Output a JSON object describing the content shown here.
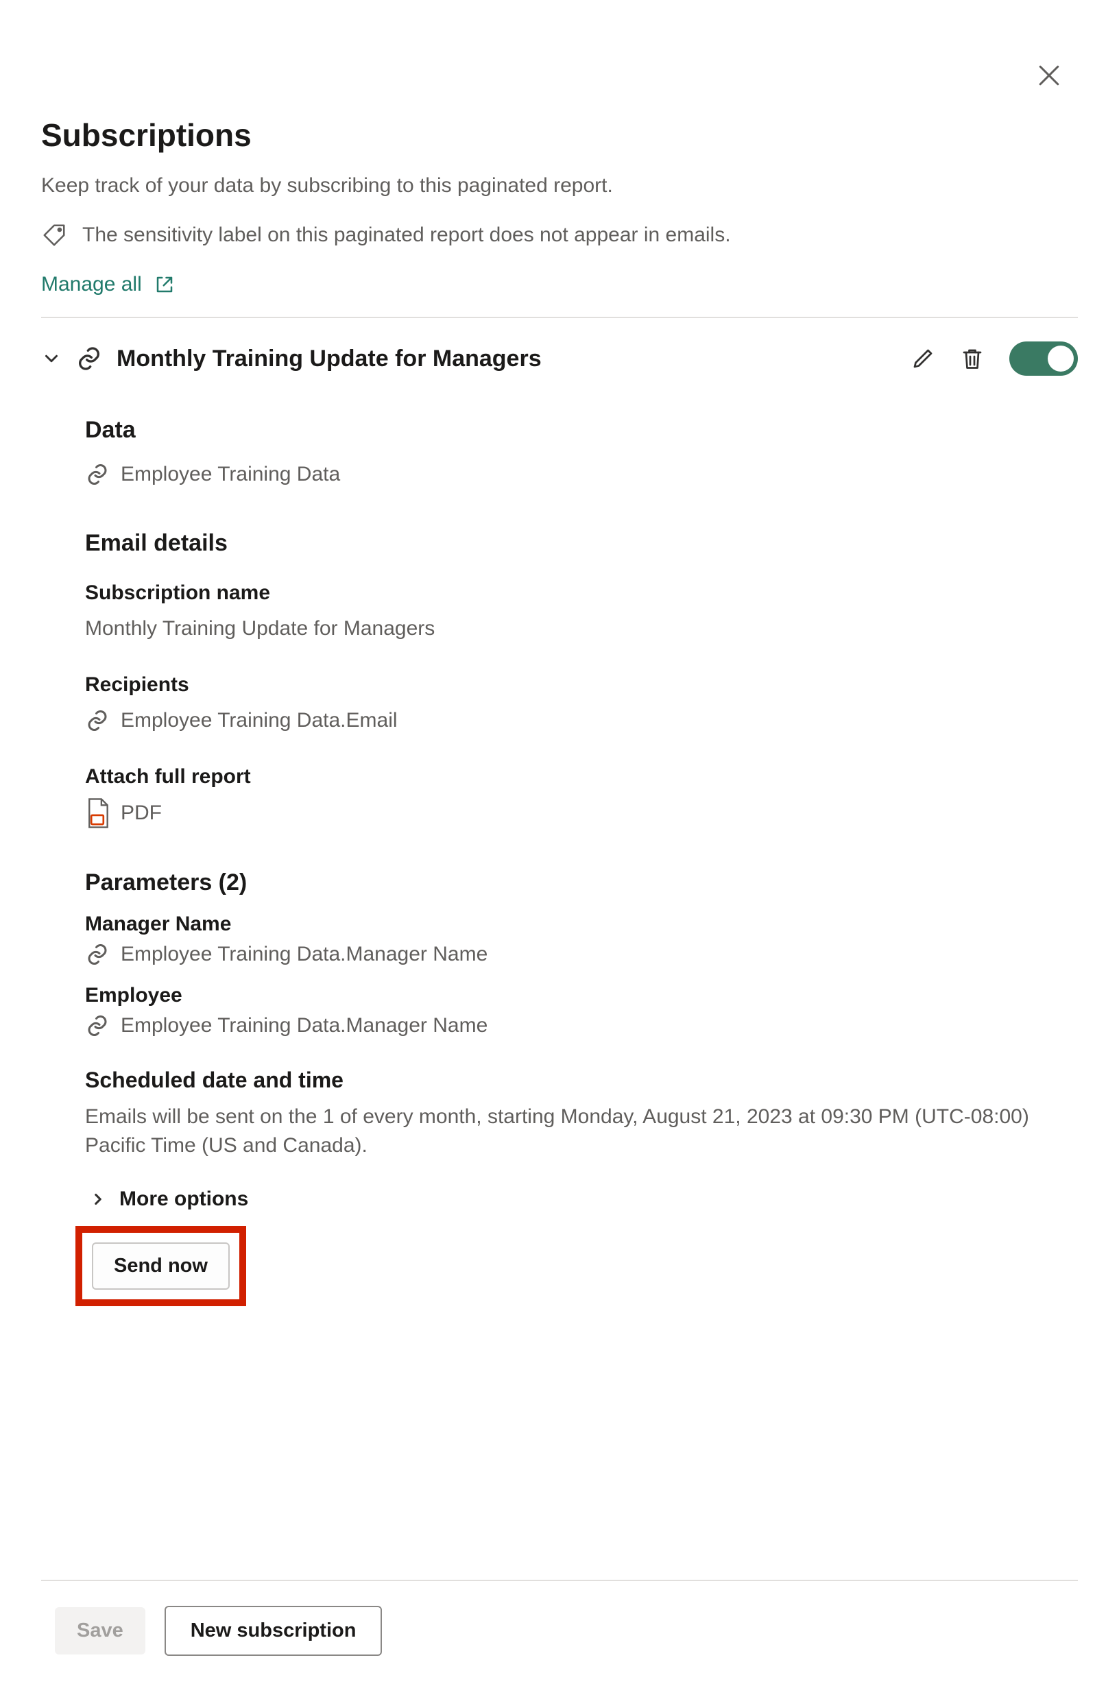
{
  "header": {
    "title": "Subscriptions",
    "subtitle": "Keep track of your data by subscribing to this paginated report.",
    "sensitivity_note": "The sensitivity label on this paginated report does not appear in emails.",
    "manage_all": "Manage all"
  },
  "subscription": {
    "name": "Monthly Training Update for Managers",
    "enabled": true,
    "data": {
      "heading": "Data",
      "value": "Employee Training Data"
    },
    "email_details": {
      "heading": "Email details",
      "name_label": "Subscription name",
      "name_value": "Monthly Training Update for Managers",
      "recipients_label": "Recipients",
      "recipients_value": "Employee Training Data.Email",
      "attach_label": "Attach full report",
      "attach_format": "PDF"
    },
    "parameters": {
      "heading": "Parameters (2)",
      "items": [
        {
          "label": "Manager Name",
          "value": "Employee Training Data.Manager Name"
        },
        {
          "label": "Employee",
          "value": "Employee Training Data.Manager Name"
        }
      ]
    },
    "schedule": {
      "heading": "Scheduled date and time",
      "description": "Emails will be sent on the 1 of every month, starting Monday, August 21, 2023 at 09:30 PM (UTC-08:00) Pacific Time (US and Canada)."
    },
    "more_options": "More options",
    "send_now": "Send now"
  },
  "footer": {
    "save": "Save",
    "new_subscription": "New subscription"
  }
}
